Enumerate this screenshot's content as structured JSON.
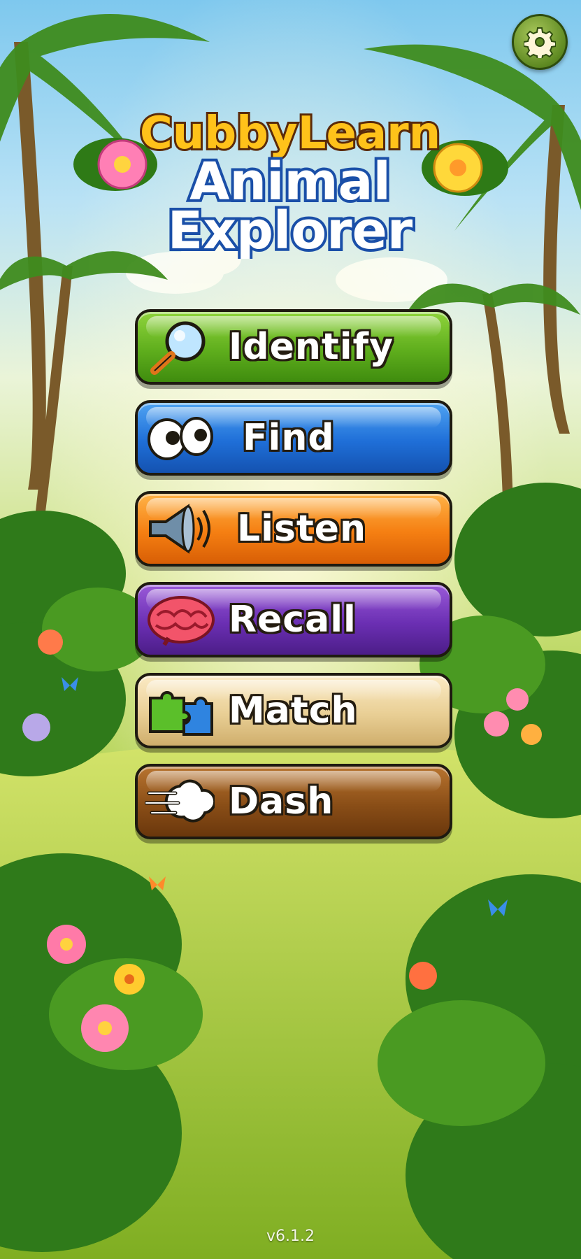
{
  "app": {
    "brand": "CubbyLearn",
    "title_line1": "Animal",
    "title_line2": "Explorer"
  },
  "settings": {
    "icon": "gear-icon"
  },
  "menu": {
    "buttons": [
      {
        "label": "Identify",
        "icon": "magnifier-icon",
        "color": "#5fae1d"
      },
      {
        "label": "Find",
        "icon": "eyes-icon",
        "color": "#1f6fd8"
      },
      {
        "label": "Listen",
        "icon": "speaker-icon",
        "color": "#f57f12"
      },
      {
        "label": "Recall",
        "icon": "brain-icon",
        "color": "#6b2fb3"
      },
      {
        "label": "Match",
        "icon": "puzzle-icon",
        "color": "#e9cf95"
      },
      {
        "label": "Dash",
        "icon": "dash-cloud-icon",
        "color": "#8a4e17"
      }
    ]
  },
  "footer": {
    "version": "v6.1.2"
  }
}
